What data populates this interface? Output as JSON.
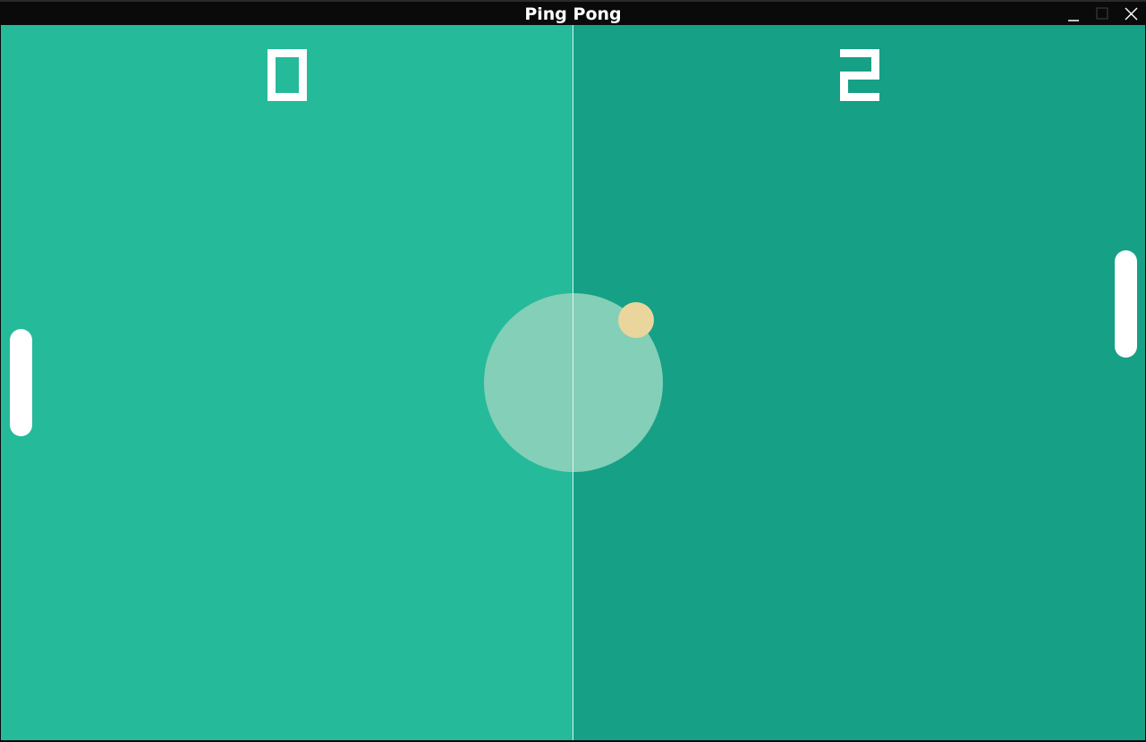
{
  "window": {
    "title": "Ping Pong",
    "controls": {
      "minimize_icon": "minimize-icon",
      "maximize_icon": "maximize-icon",
      "close_icon": "close-icon"
    }
  },
  "game": {
    "score_left": "0",
    "score_right": "2",
    "colors": {
      "left_court": "#25BA9A",
      "right_court": "#16A086",
      "center_circle": "#84CFB7",
      "net": "#DFF3EE",
      "paddle": "#FFFFFF",
      "ball": "#EAD69C",
      "score": "#FFFFFF"
    }
  }
}
